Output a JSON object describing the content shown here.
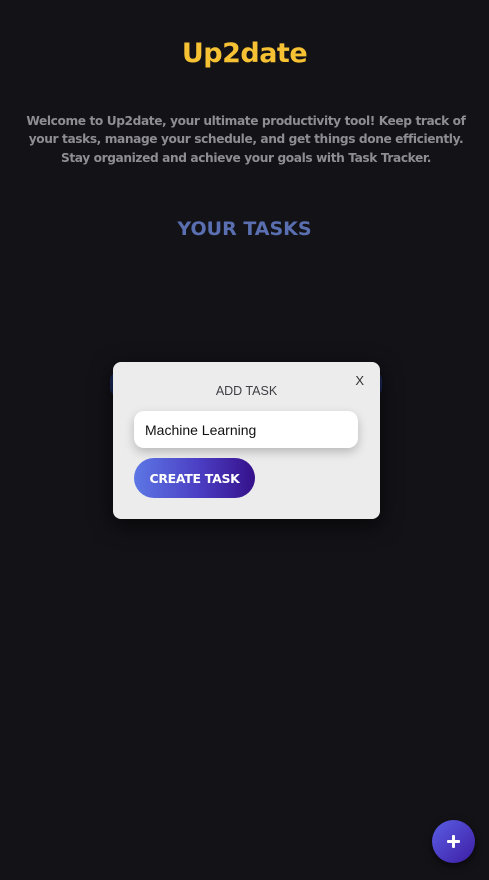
{
  "app": {
    "title": "Up2date",
    "welcome": "Welcome to Up2date, your ultimate productivity tool! Keep track of your tasks, manage your schedule, and get things done efficiently. Stay organized and achieve your goals with Task Tracker."
  },
  "tasks_section": {
    "title": "YOUR TASKS"
  },
  "add_task_modal": {
    "title": "ADD TASK",
    "close_label": "X",
    "task_input_value": "Machine Learning",
    "create_label": "CREATE TASK"
  },
  "fab": {
    "icon": "plus-icon"
  },
  "colors": {
    "background": "#121217",
    "title": "#f6c234",
    "section_title": "#5a6fb0",
    "modal_bg": "#ececec",
    "button_gradient_start": "#5c77e5",
    "button_gradient_end": "#35108a"
  }
}
